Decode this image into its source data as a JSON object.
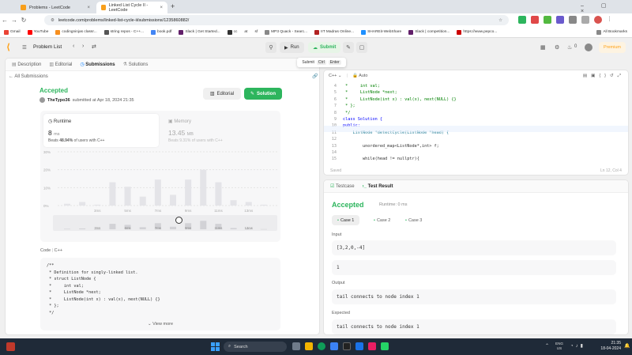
{
  "browser": {
    "tabs": [
      {
        "label": "Problems - LeetCode"
      },
      {
        "label": "Linked List Cycle II - LeetCode"
      }
    ],
    "url": "leetcode.com/problems/linked-list-cycle-ii/submissions/1235860882/",
    "bookmarks": [
      "Gmail",
      "YouTube",
      "codingninjas classr...",
      "string repos - C++...",
      "book.pdf",
      "Slack | Get Started...",
      "cc",
      "at",
      "sf",
      "MP3 Quack - Searc...",
      "IIT Madras Online...",
      "SHAREit-WebShare",
      "Slack | competition...",
      "https://www.pepco...",
      "All Bookmarks"
    ]
  },
  "lcnav": {
    "problem_list": "Problem List",
    "run": "Run",
    "submit": "Submit",
    "streak": "0",
    "premium": "Premium",
    "tooltip": {
      "label": "Submit",
      "key1": "Ctrl",
      "key2": "Enter"
    }
  },
  "left": {
    "tabs": [
      "Description",
      "Editorial",
      "Submissions",
      "Solutions"
    ],
    "back": "All Submissions",
    "status": "Accepted",
    "user": "TheTypo36",
    "submitted": "submitted at Apr 18, 2024 21:35",
    "editorial_btn": "Editorial",
    "solution_btn": "Solution",
    "runtime": {
      "label": "Runtime",
      "value": "8",
      "unit": "ms",
      "beats_prefix": "Beats",
      "beats": "48.94%",
      "beats_suffix": "of users with C++"
    },
    "memory": {
      "label": "Memory",
      "value": "13.45",
      "unit": "MB",
      "beats_prefix": "Beats",
      "beats": "9.31%",
      "beats_suffix": "of users with C++"
    },
    "code_label": "Code",
    "lang": "C++",
    "code_lines": [
      "/**",
      " * Definition for singly-linked list.",
      " * struct ListNode {",
      " *     int val;",
      " *     ListNode *next;",
      " *     ListNode(int x) : val(x), next(NULL) {}",
      " * };",
      " */"
    ],
    "view_more": "View more"
  },
  "chart_data": {
    "type": "bar",
    "y_ticks": [
      "30%",
      "20%",
      "10%",
      "0%"
    ],
    "ylim": [
      0,
      30
    ],
    "x_ticks": [
      "3ms",
      "5ms",
      "7ms",
      "9ms",
      "11ms",
      "13ms"
    ],
    "values": [
      1,
      2,
      0.5,
      13,
      10.5,
      5,
      14.5,
      6,
      14.5,
      20,
      13,
      3,
      2,
      0.5
    ],
    "mini_labels": [
      "3ms",
      "6ms",
      "7ms",
      "9ms",
      "11ms",
      "13ms"
    ],
    "grid": true
  },
  "editor": {
    "lang": "C++",
    "auto": "Auto",
    "lines": [
      {
        "n": "4",
        "t": " *     int val;"
      },
      {
        "n": "5",
        "t": " *     ListNode *next;"
      },
      {
        "n": "6",
        "t": " *     ListNode(int x) : val(x), next(NULL) {}"
      },
      {
        "n": "7",
        "t": " * };"
      },
      {
        "n": "8",
        "t": " */"
      },
      {
        "n": "9",
        "t": "class Solution {"
      },
      {
        "n": "10",
        "t": "public:"
      },
      {
        "n": "11",
        "t": "    ListNode *detectCycle(ListNode *head) {"
      },
      {
        "n": "12",
        "t": ""
      },
      {
        "n": "13",
        "t": "        unordered_map<ListNode*,int> f;"
      },
      {
        "n": "14",
        "t": ""
      },
      {
        "n": "15",
        "t": "        while(head != nullptr){"
      }
    ],
    "saved": "Saved",
    "pos": "Ln 12, Col 4"
  },
  "result": {
    "tabs": [
      "Testcase",
      "Test Result"
    ],
    "status": "Accepted",
    "runtime": "Runtime: 0 ms",
    "cases": [
      "Case 1",
      "Case 2",
      "Case 3"
    ],
    "input_label": "Input",
    "input": "[3,2,0,-4]",
    "input2": "1",
    "output_label": "Output",
    "output": "tail connects to node index 1",
    "expected_label": "Expected",
    "expected": "tail connects to node index 1"
  },
  "taskbar": {
    "search": "Search",
    "lang1": "ENG",
    "lang2": "US",
    "time": "21:35",
    "date": "18-04-2024"
  },
  "colors": {
    "accent": "#2db55d",
    "brand": "#ffa116"
  }
}
